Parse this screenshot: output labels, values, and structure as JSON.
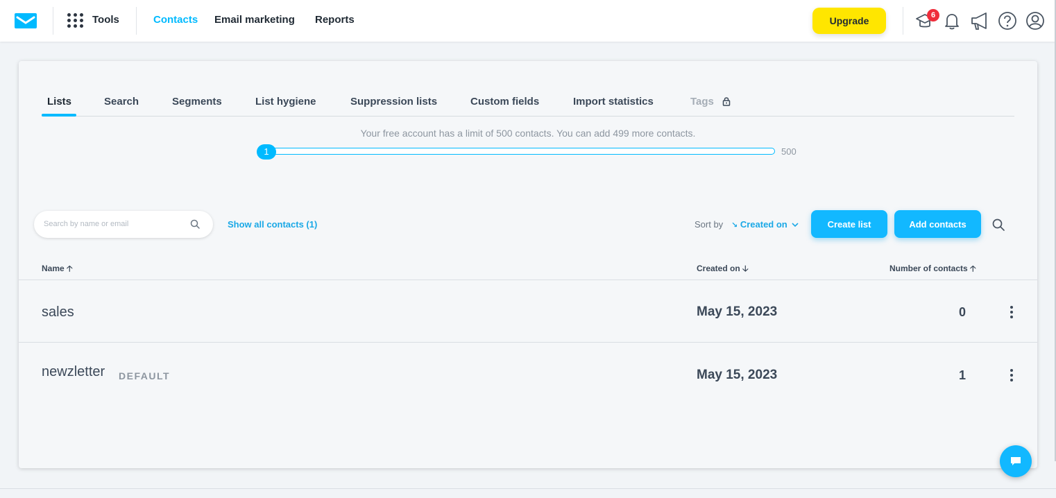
{
  "nav": {
    "tools_label": "Tools",
    "links": [
      "Contacts",
      "Email marketing",
      "Reports"
    ],
    "active_link": "Contacts",
    "upgrade_label": "Upgrade",
    "notification_count": "6",
    "icons": [
      "graduation-cap-icon",
      "bell-icon",
      "megaphone-icon",
      "help-icon",
      "user-icon"
    ]
  },
  "tabs": {
    "items": [
      "Lists",
      "Search",
      "Segments",
      "List hygiene",
      "Suppression lists",
      "Custom fields",
      "Import statistics",
      "Tags"
    ],
    "active": "Lists",
    "locked": "Tags"
  },
  "limit": {
    "text": "Your free account has a limit of 500 contacts. You can add 499 more contacts.",
    "current": "1",
    "max": "500",
    "fraction": 0.002
  },
  "toolbar": {
    "search_placeholder": "Search by name or email",
    "show_all": "Show all contacts (1)",
    "sort_label": "Sort by",
    "sort_value": "Created on",
    "create_list": "Create list",
    "add_contacts": "Add contacts"
  },
  "table": {
    "headers": {
      "name": "Name",
      "created": "Created on",
      "count": "Number of contacts"
    },
    "rows": [
      {
        "name": "sales",
        "tag": "",
        "created": "May 15, 2023",
        "count": "0"
      },
      {
        "name": "newzletter",
        "tag": "DEFAULT",
        "created": "May 15, 2023",
        "count": "1"
      }
    ]
  },
  "colors": {
    "accent": "#00baff",
    "upgrade": "#ffe600",
    "badge": "#ef2d3b"
  }
}
